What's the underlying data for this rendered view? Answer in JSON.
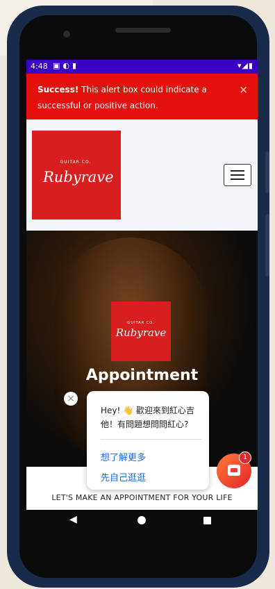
{
  "status_bar": {
    "time": "4:48",
    "icons": [
      "notification-a-icon",
      "app-icon",
      "sdcard-icon"
    ],
    "right_icons": "▾◢▮"
  },
  "alert": {
    "title": "Success!",
    "message": " This alert box could indicate a successful or positive action.",
    "close": "×",
    "color": "#e3100b"
  },
  "header": {
    "logo_small": "GUITAR CO.",
    "logo_script": "Rubyrave"
  },
  "hero": {
    "logo_small": "GUITAR CO.",
    "logo_script": "Rubyrave",
    "title": "Appointment"
  },
  "section": {
    "tagline": "LET'S MAKE AN APPOINTMENT FOR YOUR LIFE"
  },
  "chat": {
    "message": "Hey! 👋 歡迎來到紅心吉他！有問題想問問紅心?",
    "link1": "想了解更多",
    "link2": "先自己逛逛",
    "badge": "1",
    "close": "×"
  },
  "nav": {
    "back": "◀"
  },
  "colors": {
    "brand_red": "#d81e1e",
    "status_bar": "#3b00c4",
    "link_blue": "#1a6bd8"
  }
}
